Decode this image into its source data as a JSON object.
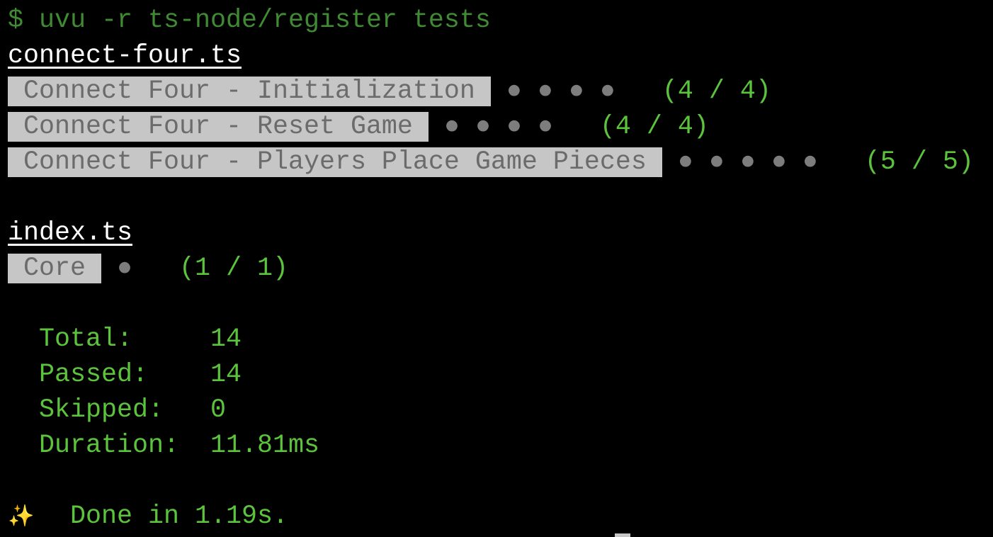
{
  "command": "$ uvu -r ts-node/register tests",
  "files": [
    {
      "name": "connect-four.ts",
      "suites": [
        {
          "name": " Connect Four - Initialization ",
          "passed": 4,
          "result": "(4 / 4)"
        },
        {
          "name": " Connect Four - Reset Game ",
          "passed": 4,
          "result": "(4 / 4)"
        },
        {
          "name": " Connect Four - Players Place Game Pieces ",
          "passed": 5,
          "result": "(5 / 5)"
        }
      ]
    },
    {
      "name": "index.ts",
      "suites": [
        {
          "name": " Core ",
          "passed": 1,
          "result": "(1 / 1)"
        }
      ]
    }
  ],
  "summary": {
    "total_label": "  Total:     ",
    "total": "14",
    "passed_label": "  Passed:    ",
    "passed": "14",
    "skipped_label": "  Skipped:   ",
    "skipped": "0",
    "duration_label": "  Duration:  ",
    "duration": "11.81ms"
  },
  "done": {
    "icon": "sparkles-icon",
    "glyph": "✨",
    "text": "  Done in 1.19s."
  },
  "colors": {
    "green": "#5cc33d",
    "command": "#3f8a33",
    "highlight": "#c6c6c6"
  }
}
